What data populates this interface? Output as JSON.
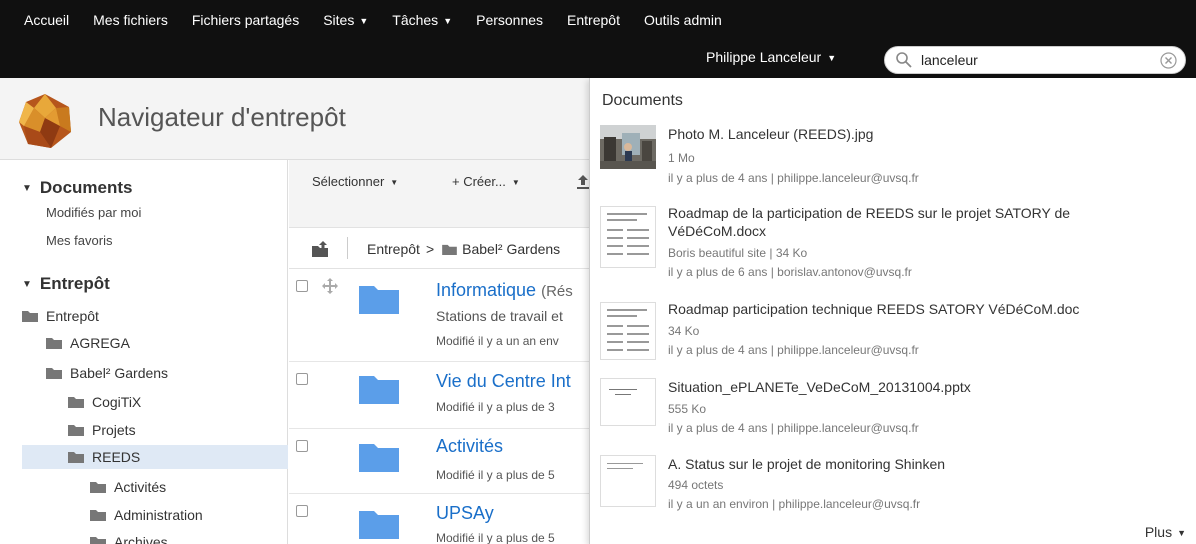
{
  "topnav": {
    "items": [
      {
        "label": "Accueil",
        "caret": false
      },
      {
        "label": "Mes fichiers",
        "caret": false
      },
      {
        "label": "Fichiers partagés",
        "caret": false
      },
      {
        "label": "Sites",
        "caret": true
      },
      {
        "label": "Tâches",
        "caret": true
      },
      {
        "label": "Personnes",
        "caret": false
      },
      {
        "label": "Entrepôt",
        "caret": false
      },
      {
        "label": "Outils admin",
        "caret": false
      }
    ],
    "user_name": "Philippe Lanceleur",
    "search_value": "lanceleur"
  },
  "header": {
    "title": "Navigateur d'entrepôt"
  },
  "sidebar": {
    "documents_title": "Documents",
    "links": [
      "Modifiés par moi",
      "Mes favoris"
    ],
    "repo_title": "Entrepôt",
    "tree": [
      "Entrepôt",
      "AGREGA",
      "Babel² Gardens",
      "CogiTiX",
      "Projets",
      "REEDS",
      "Activités",
      "Administration",
      "Archives"
    ]
  },
  "toolbar": {
    "select_label": "Sélectionner",
    "create_label": "+ Créer...",
    "breadcrumb_root": "Entrepôt",
    "breadcrumb_sep": ">",
    "breadcrumb_folder": "Babel² Gardens"
  },
  "rows": [
    {
      "title": "Informatique",
      "note": "(Rés",
      "subtitle": "Stations de travail et",
      "meta": "Modifié il y a un an env"
    },
    {
      "title": "Vie du Centre Int",
      "meta": "Modifié il y a plus de 3"
    },
    {
      "title": "Activités",
      "meta": "Modifié il y a plus de 5"
    },
    {
      "title": "UPSAy",
      "meta": "Modifié il y a plus de 5"
    }
  ],
  "search_results": {
    "heading": "Documents",
    "items": [
      {
        "title": "Photo M. Lanceleur (REEDS).jpg",
        "line2": "1 Mo",
        "line3": "il y a plus de 4 ans | philippe.lanceleur@uvsq.fr",
        "thumb": "photo"
      },
      {
        "title": "Roadmap de la participation de REEDS sur le projet SATORY de VéDéCoM.docx",
        "line2": "Boris beautiful site | 34 Ko",
        "line3": "il y a plus de 6 ans | borislav.antonov@uvsq.fr",
        "thumb": "doc"
      },
      {
        "title": "Roadmap participation technique REEDS SATORY VéDéCoM.doc",
        "line2": "34 Ko",
        "line3": "il y a plus de 4 ans | philippe.lanceleur@uvsq.fr",
        "thumb": "doc"
      },
      {
        "title": "Situation_ePLANETe_VeDeCoM_20131004.pptx",
        "line2": "555 Ko",
        "line3": "il y a plus de 4 ans | philippe.lanceleur@uvsq.fr",
        "thumb": "slide"
      },
      {
        "title": "A. Status sur le projet de monitoring Shinken",
        "line2": "494 octets",
        "line3": "il y a un an environ | philippe.lanceleur@uvsq.fr",
        "thumb": "doc"
      }
    ],
    "more_label": "Plus"
  },
  "colors": {
    "topbar": "#101010",
    "link": "#1a6fc9",
    "folder": "#5b9ee9",
    "selected": "#dfe9f5"
  }
}
